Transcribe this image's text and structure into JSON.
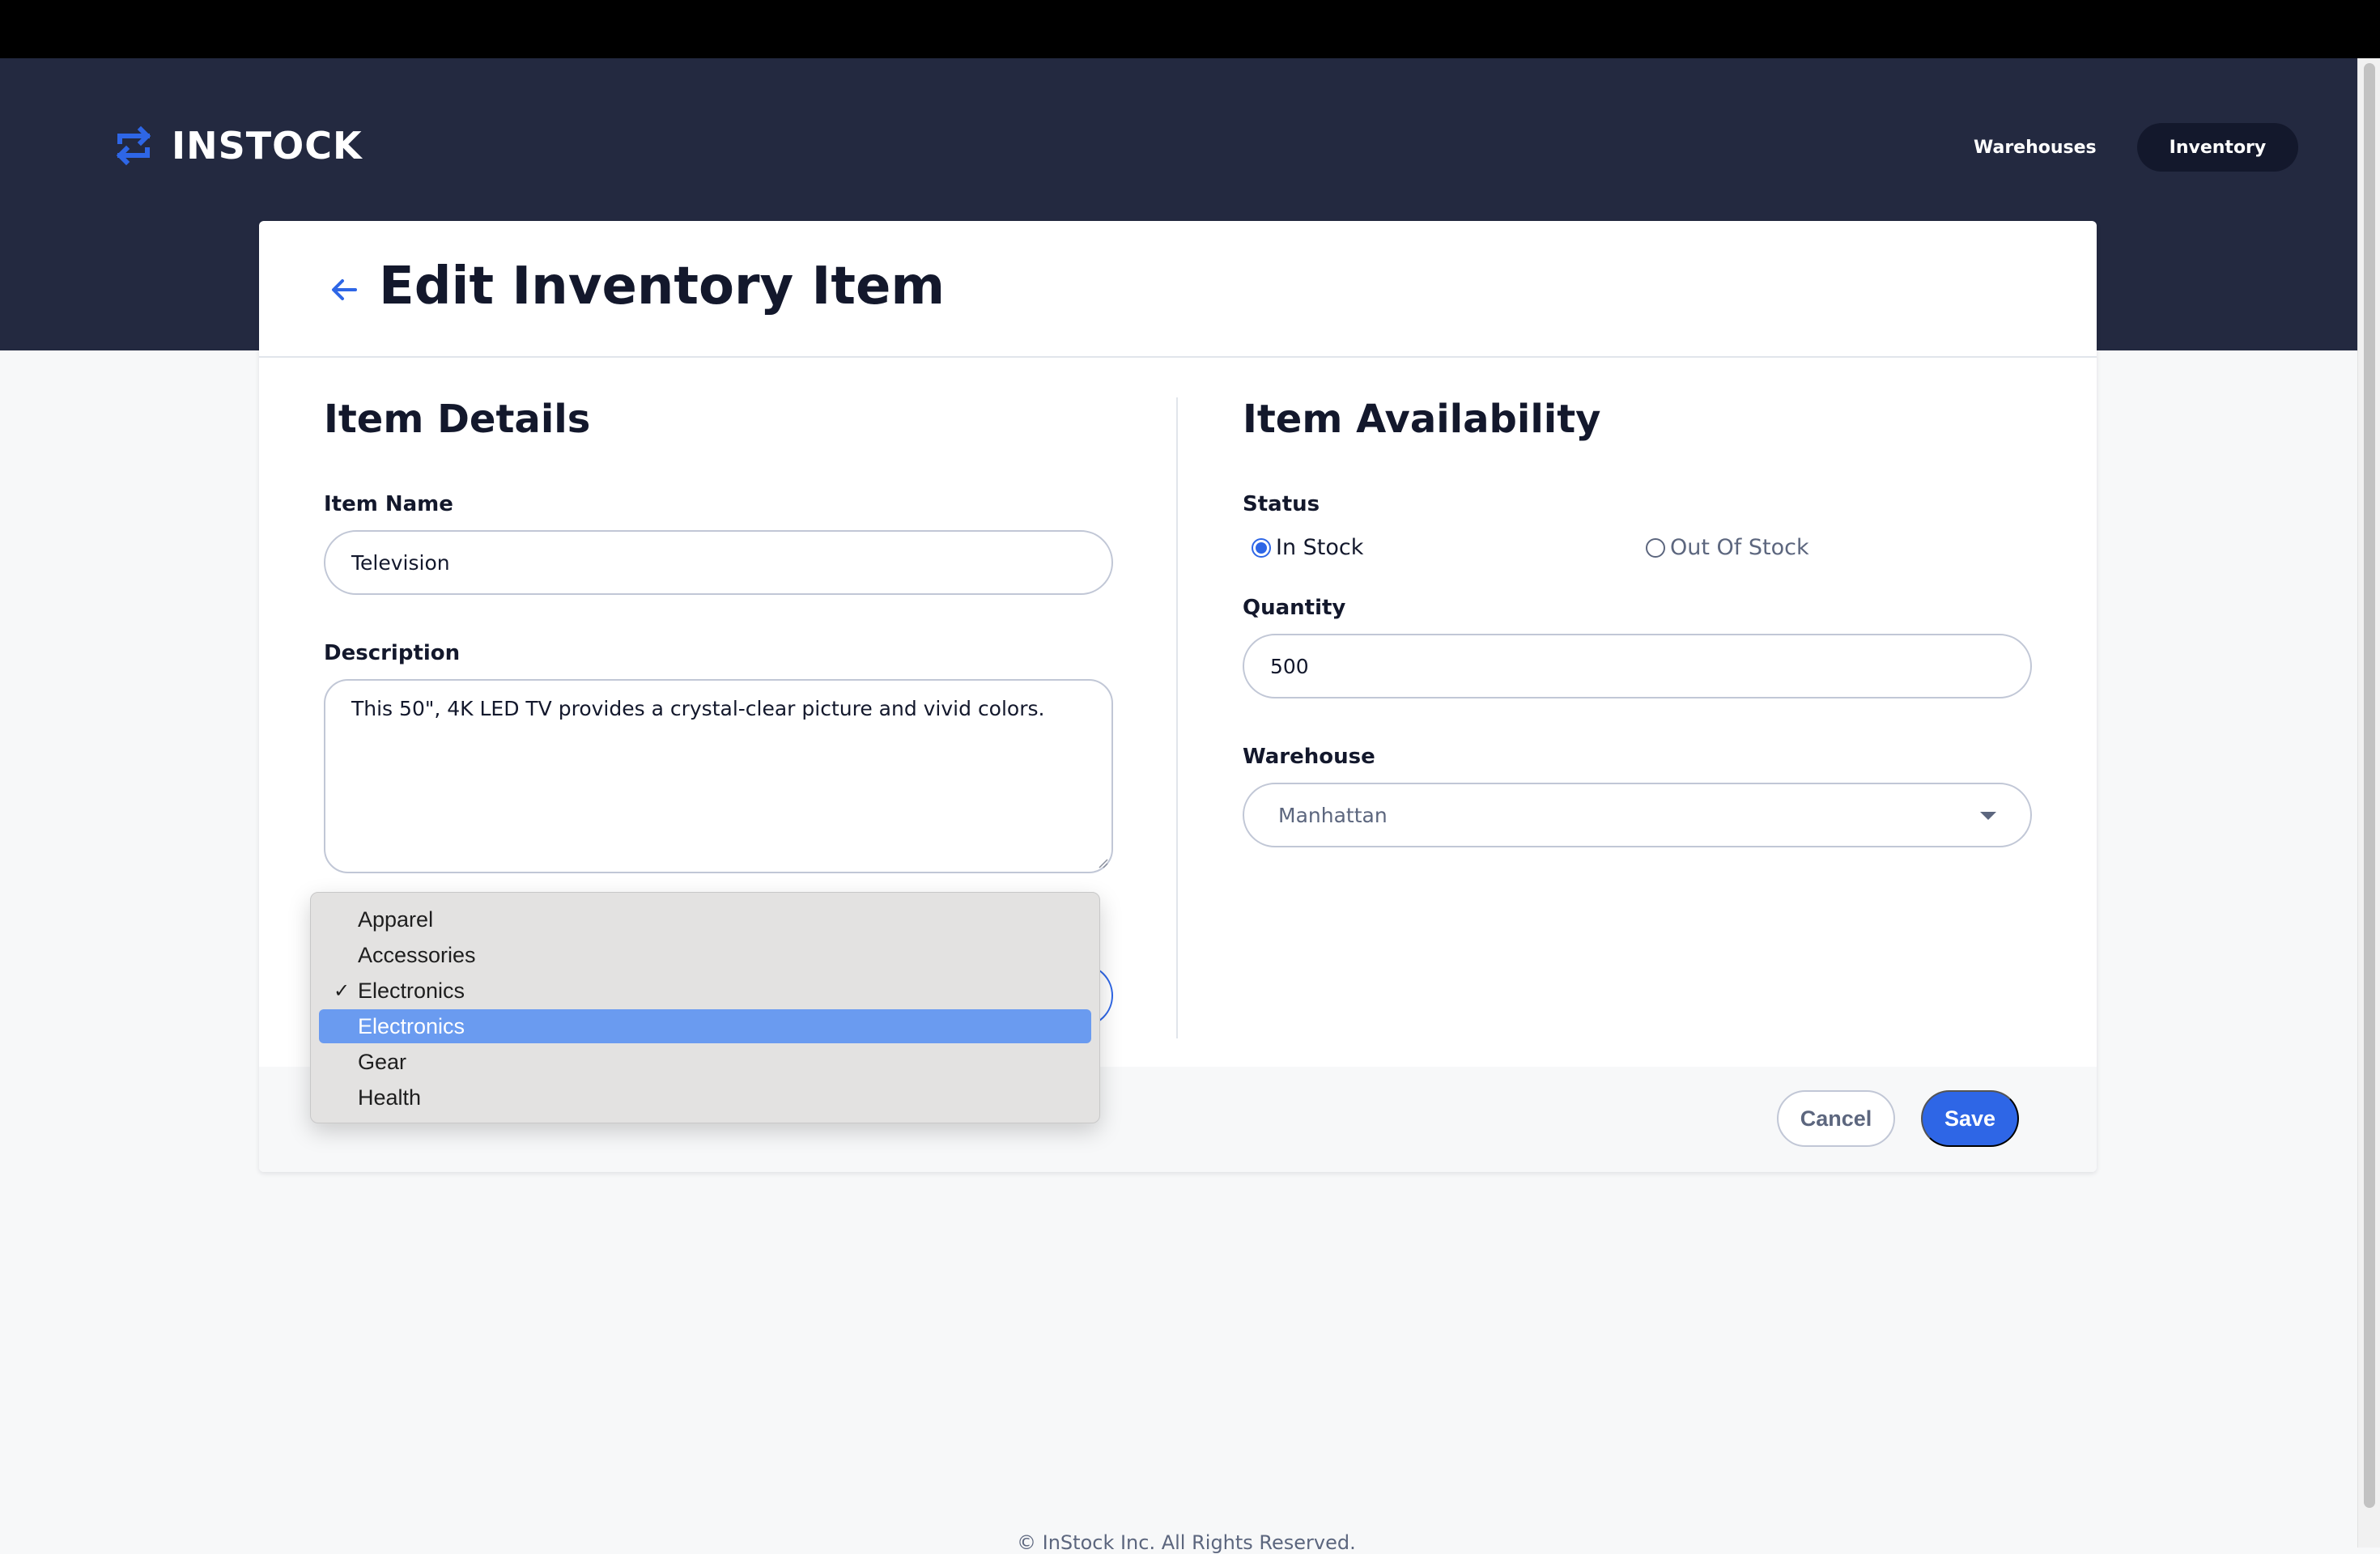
{
  "app": {
    "name": "INSTOCK"
  },
  "nav": {
    "items": [
      {
        "label": "Warehouses"
      },
      {
        "label": "Inventory"
      }
    ]
  },
  "page": {
    "title": "Edit Inventory Item"
  },
  "details": {
    "title": "Item Details",
    "name_label": "Item Name",
    "name_value": "Television",
    "description_label": "Description",
    "description_value": "This 50\", 4K LED TV provides a crystal-clear picture and vivid colors."
  },
  "availability": {
    "title": "Item Availability",
    "status_label": "Status",
    "status_options": [
      {
        "label": "In Stock",
        "checked": true
      },
      {
        "label": "Out Of Stock",
        "checked": false
      }
    ],
    "quantity_label": "Quantity",
    "quantity_value": "500",
    "warehouse_label": "Warehouse",
    "warehouse_value": "Manhattan"
  },
  "category_dropdown": {
    "options": [
      {
        "label": "Apparel"
      },
      {
        "label": "Accessories"
      },
      {
        "label": "Electronics",
        "checked": true
      },
      {
        "label": "Electronics",
        "highlighted": true
      },
      {
        "label": "Gear"
      },
      {
        "label": "Health"
      }
    ],
    "check_glyph": "✓"
  },
  "actions": {
    "cancel": "Cancel",
    "save": "Save"
  },
  "footer": {
    "copyright": "© InStock Inc. All Rights Reserved."
  },
  "colors": {
    "accent": "#2E66E6",
    "header_bg": "#232940",
    "page_bg": "#F7F8F9",
    "text_dark": "#13182C",
    "text_muted": "#5C667E",
    "border": "#C1C7D6"
  },
  "icons": {
    "logo": "instock-arrows-icon",
    "back": "arrow-back-icon",
    "caret": "caret-down-icon",
    "check": "checkmark-icon"
  }
}
